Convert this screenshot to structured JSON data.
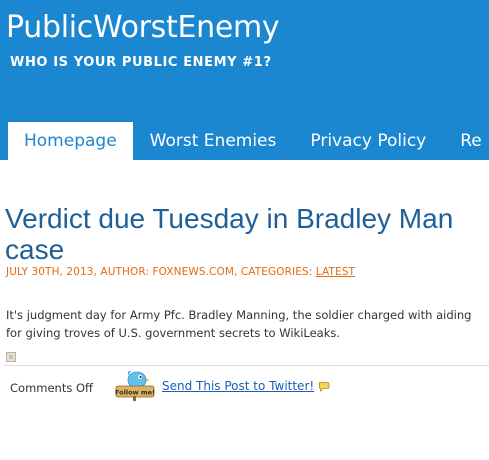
{
  "site": {
    "title": "PublicWorstEnemy",
    "tagline": "WHO IS YOUR PUBLIC ENEMY #1?"
  },
  "nav": {
    "items": [
      {
        "label": "Homepage",
        "active": true
      },
      {
        "label": "Worst Enemies",
        "active": false
      },
      {
        "label": "Privacy Policy",
        "active": false
      },
      {
        "label": "Re",
        "active": false
      }
    ]
  },
  "post": {
    "title_line1": "Verdict due Tuesday in Bradley Man",
    "title_line2": "case",
    "meta_text": "JULY 30TH, 2013, AUTHOR: FOXNEWS.COM, CATEGORIES: ",
    "category": "LATEST",
    "excerpt_line1": "It's judgment day for Army Pfc. Bradley Manning, the soldier charged with aiding",
    "excerpt_line2": "for giving troves of U.S. government secrets to WikiLeaks.",
    "comments": "Comments Off",
    "bird_badge": "Follow me!",
    "send_link": "Send This Post to Twitter!"
  },
  "colors": {
    "header_bg": "#1b87d0",
    "title_blue": "#1f5f98",
    "meta_orange": "#e56a12",
    "link_blue": "#1b5fb8"
  },
  "icons": {
    "follow_bird": "twitter-bird-follow-me-icon",
    "tweet_mini": "tweet-bubble-icon",
    "post_image": "broken-image-icon"
  }
}
